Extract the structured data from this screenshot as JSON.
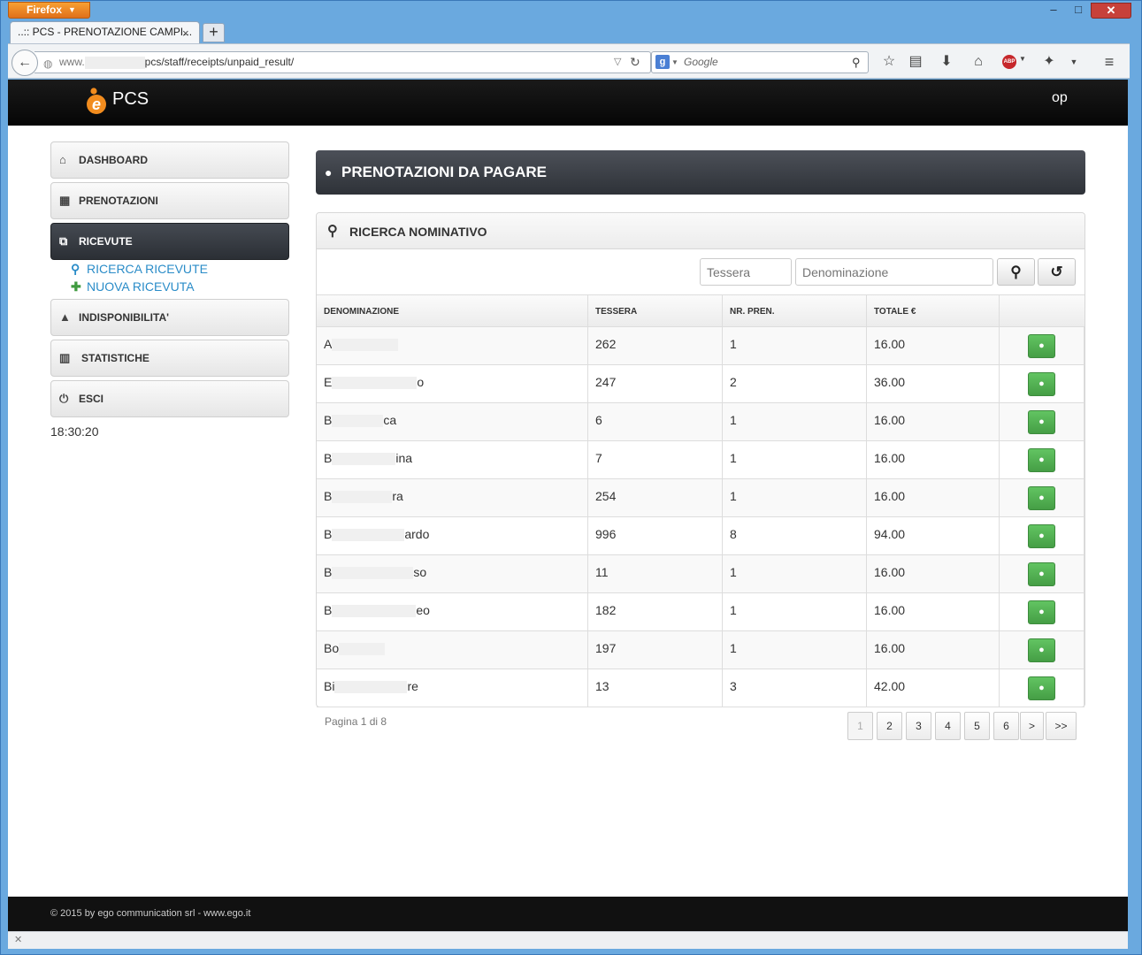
{
  "browser": {
    "menu_label": "Firefox",
    "window_controls": {
      "minimize": "–",
      "maximize": "□",
      "close": "✕"
    },
    "tab": {
      "title": "..:: PCS - PRENOTAZIONE CAMPI...",
      "close": "×"
    },
    "new_tab": "+",
    "url": {
      "prefix": "www.",
      "path": "pcs/staff/receipts/unpaid_result/"
    },
    "search": {
      "engine": "g",
      "placeholder": "Google"
    },
    "toolbar_icons": [
      "star-icon",
      "bookmarks-icon",
      "download-icon",
      "home-icon",
      "adblock-icon",
      "extension-icon",
      "overflow-icon",
      "menu-icon"
    ],
    "adblock_label": "ABP"
  },
  "app": {
    "brand": "PCS",
    "user": "op"
  },
  "sidebar": {
    "items": [
      {
        "label": "DASHBOARD",
        "icon": "home-icon"
      },
      {
        "label": "PRENOTAZIONI",
        "icon": "calendar-icon"
      },
      {
        "label": "RICEVUTE",
        "icon": "receipt-icon",
        "active": true
      },
      {
        "label": "INDISPONIBILITA'",
        "icon": "warning-icon"
      },
      {
        "label": "STATISTICHE",
        "icon": "bar-chart-icon"
      },
      {
        "label": "ESCI",
        "icon": "power-icon"
      }
    ],
    "subitems": [
      {
        "label": "RICERCA RICEVUTE",
        "icon": "search-icon"
      },
      {
        "label": "NUOVA RICEVUTA",
        "icon": "plus-icon"
      }
    ],
    "clock": "18:30:20"
  },
  "main": {
    "title": "PRENOTAZIONI DA PAGARE",
    "search_panel": {
      "title": "RICERCA NOMINATIVO",
      "tessera_placeholder": "Tessera",
      "denominazione_placeholder": "Denominazione"
    },
    "table": {
      "columns": [
        "DENOMINAZIONE",
        "TESSERA",
        "NR. PREN.",
        "TOTALE €"
      ],
      "rows": [
        {
          "name_start": "A",
          "name_end": "",
          "tessera": "262",
          "nr_pren": "1",
          "totale": "16.00"
        },
        {
          "name_start": "E",
          "name_end": "o",
          "tessera": "247",
          "nr_pren": "2",
          "totale": "36.00"
        },
        {
          "name_start": "B",
          "name_end": "ca",
          "tessera": "6",
          "nr_pren": "1",
          "totale": "16.00"
        },
        {
          "name_start": "B",
          "name_end": "ina",
          "tessera": "7",
          "nr_pren": "1",
          "totale": "16.00"
        },
        {
          "name_start": "B",
          "name_end": "ra",
          "tessera": "254",
          "nr_pren": "1",
          "totale": "16.00"
        },
        {
          "name_start": "B",
          "name_end": "ardo",
          "tessera": "996",
          "nr_pren": "8",
          "totale": "94.00"
        },
        {
          "name_start": "B",
          "name_end": "so",
          "tessera": "11",
          "nr_pren": "1",
          "totale": "16.00"
        },
        {
          "name_start": "B",
          "name_end": "eo",
          "tessera": "182",
          "nr_pren": "1",
          "totale": "16.00"
        },
        {
          "name_start": "Bo",
          "name_end": "",
          "tessera": "197",
          "nr_pren": "1",
          "totale": "16.00"
        },
        {
          "name_start": "Bi",
          "name_end": "re",
          "tessera": "13",
          "nr_pren": "3",
          "totale": "42.00"
        }
      ]
    },
    "pagination": {
      "info": "Pagina 1 di 8",
      "pages": [
        "1",
        "2",
        "3",
        "4",
        "5",
        "6",
        ">",
        ">>"
      ],
      "current": "1"
    }
  },
  "footer": {
    "text": "© 2015 by ego communication srl - www.ego.it"
  },
  "colors": {
    "accent_green": "#459e45",
    "link_blue": "#2a8cc8",
    "header_dark": "#2e3238"
  }
}
